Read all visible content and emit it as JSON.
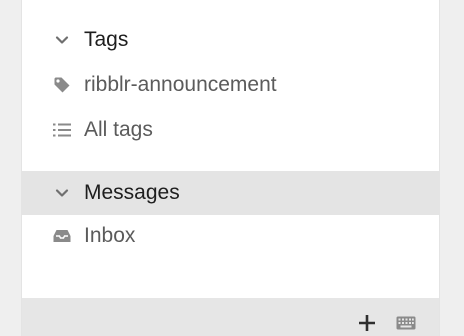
{
  "sidebar": {
    "tags_section": {
      "label": "Tags",
      "items": [
        {
          "label": "ribblr-announcement",
          "icon": "tag-icon"
        },
        {
          "label": "All tags",
          "icon": "list-icon"
        }
      ]
    },
    "messages_section": {
      "label": "Messages",
      "items": [
        {
          "label": "Inbox",
          "icon": "inbox-icon"
        }
      ]
    }
  },
  "footer": {
    "actions": [
      {
        "icon": "plus-icon"
      },
      {
        "icon": "keyboard-icon"
      }
    ]
  }
}
